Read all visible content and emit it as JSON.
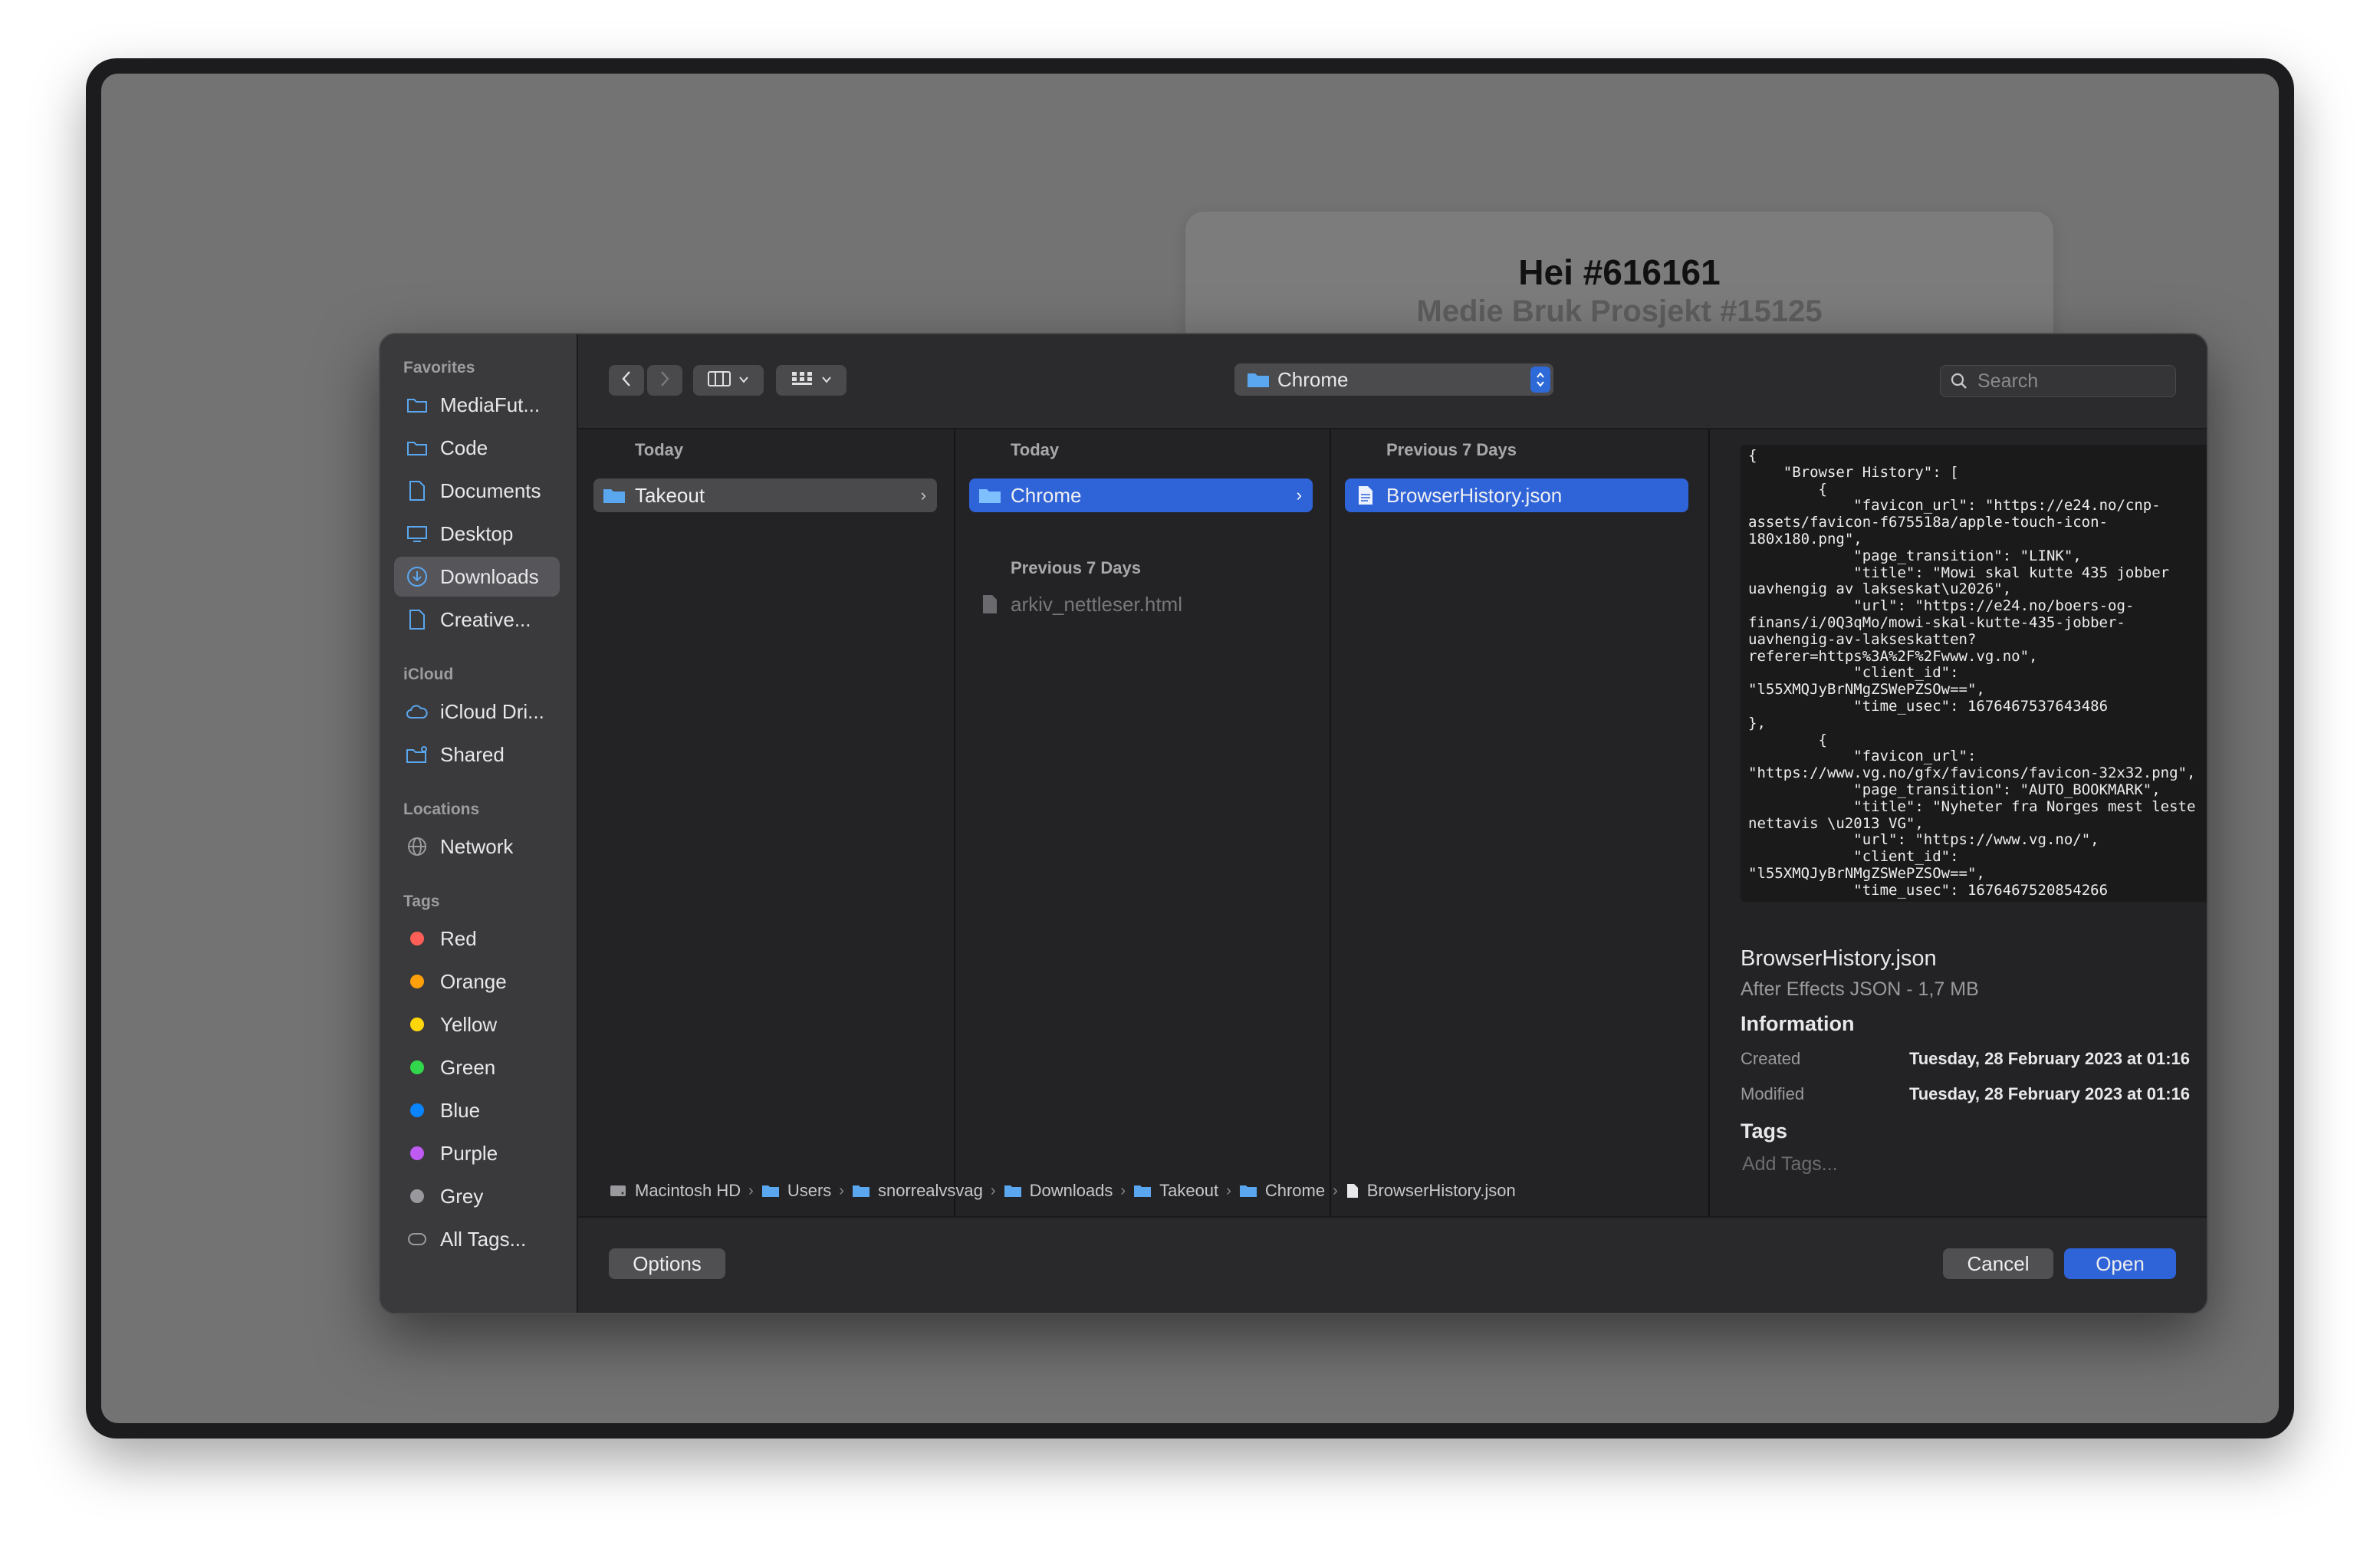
{
  "background": {
    "title": "Hei #616161",
    "subtitle": "Medie Bruk Prosjekt #15125"
  },
  "sidebar": {
    "favorites_header": "Favorites",
    "favorites": [
      {
        "label": "MediaFut...",
        "icon": "folder-icon"
      },
      {
        "label": "Code",
        "icon": "folder-icon"
      },
      {
        "label": "Documents",
        "icon": "document-icon"
      },
      {
        "label": "Desktop",
        "icon": "desktop-icon"
      },
      {
        "label": "Downloads",
        "icon": "download-icon",
        "selected": true
      },
      {
        "label": "Creative...",
        "icon": "document-icon"
      }
    ],
    "icloud_header": "iCloud",
    "icloud": [
      {
        "label": "iCloud Dri...",
        "icon": "cloud-icon"
      },
      {
        "label": "Shared",
        "icon": "shared-folder-icon"
      }
    ],
    "locations_header": "Locations",
    "locations": [
      {
        "label": "Network",
        "icon": "globe-icon"
      }
    ],
    "tags_header": "Tags",
    "tags": [
      {
        "label": "Red",
        "color": "#ff5f57"
      },
      {
        "label": "Orange",
        "color": "#ff9f0a"
      },
      {
        "label": "Yellow",
        "color": "#ffd60a"
      },
      {
        "label": "Green",
        "color": "#32d74b"
      },
      {
        "label": "Blue",
        "color": "#0a84ff"
      },
      {
        "label": "Purple",
        "color": "#bf5af2"
      },
      {
        "label": "Grey",
        "color": "#98989d"
      },
      {
        "label": "All Tags...",
        "color": ""
      }
    ]
  },
  "toolbar": {
    "location": "Chrome",
    "search_placeholder": "Search"
  },
  "columns": [
    {
      "sections": [
        {
          "header": "Today",
          "items": [
            {
              "label": "Takeout",
              "type": "folder",
              "state": "gray"
            }
          ]
        }
      ]
    },
    {
      "sections": [
        {
          "header": "Today",
          "items": [
            {
              "label": "Chrome",
              "type": "folder",
              "state": "selected"
            }
          ]
        },
        {
          "header": "Previous 7 Days",
          "items": [
            {
              "label": "arkiv_nettleser.html",
              "type": "file",
              "state": "dimmed"
            }
          ]
        }
      ]
    },
    {
      "sections": [
        {
          "header": "Previous 7 Days",
          "items": [
            {
              "label": "BrowserHistory.json",
              "type": "file",
              "state": "selected"
            }
          ]
        }
      ]
    }
  ],
  "preview": {
    "json_text": "{\n    \"Browser History\": [\n        {\n            \"favicon_url\": \"https://e24.no/cnp-assets/favicon-f675518a/apple-touch-icon-180x180.png\",\n            \"page_transition\": \"LINK\",\n            \"title\": \"Mowi skal kutte 435 jobber uavhengig av lakseskat\\u2026\",\n            \"url\": \"https://e24.no/boers-og-finans/i/0Q3qMo/mowi-skal-kutte-435-jobber-uavhengig-av-lakseskatten?referer=https%3A%2F%2Fwww.vg.no\",\n            \"client_id\": \"l55XMQJyBrNMgZSWePZSOw==\",\n            \"time_usec\": 1676467537643486\n},\n        {\n            \"favicon_url\": \"https://www.vg.no/gfx/favicons/favicon-32x32.png\",\n            \"page_transition\": \"AUTO_BOOKMARK\",\n            \"title\": \"Nyheter fra Norges mest leste nettavis \\u2013 VG\",\n            \"url\": \"https://www.vg.no/\",\n            \"client_id\": \"l55XMQJyBrNMgZSWePZSOw==\",\n            \"time_usec\": 1676467520854266",
    "file_name": "BrowserHistory.json",
    "kind": "After Effects JSON - 1,7 MB",
    "info_header": "Information",
    "created_label": "Created",
    "created_value": "Tuesday, 28 February 2023 at 01:16",
    "modified_label": "Modified",
    "modified_value": "Tuesday, 28 February 2023 at 01:16",
    "tags_header": "Tags",
    "add_tags": "Add Tags..."
  },
  "breadcrumbs": [
    {
      "label": "Macintosh HD",
      "icon": "disk-icon"
    },
    {
      "label": "Users",
      "icon": "folder-icon"
    },
    {
      "label": "snorrealvsvag",
      "icon": "folder-icon"
    },
    {
      "label": "Downloads",
      "icon": "folder-icon"
    },
    {
      "label": "Takeout",
      "icon": "folder-icon"
    },
    {
      "label": "Chrome",
      "icon": "folder-icon"
    },
    {
      "label": "BrowserHistory.json",
      "icon": "document-icon"
    }
  ],
  "buttons": {
    "options": "Options",
    "cancel": "Cancel",
    "open": "Open"
  },
  "colors": {
    "accent": "#2f63d8",
    "folder": "#5aa7ef"
  }
}
